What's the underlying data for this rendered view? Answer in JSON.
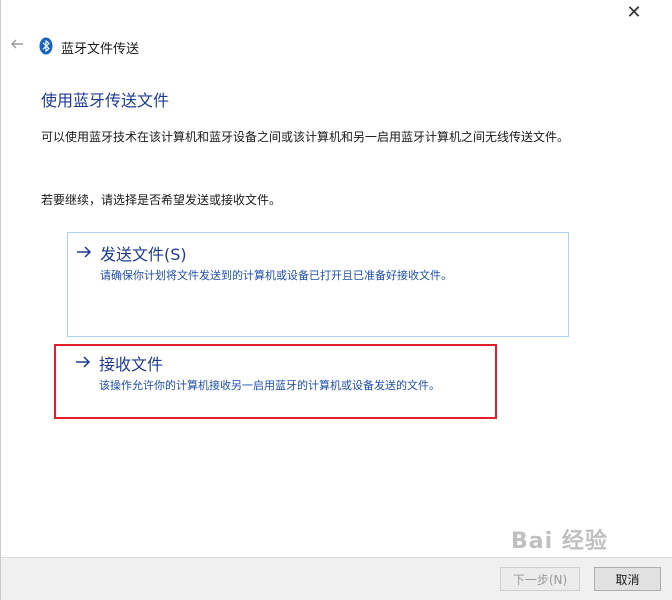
{
  "window": {
    "title": "蓝牙文件传送",
    "close_glyph": "✕"
  },
  "main": {
    "heading": "使用蓝牙传送文件",
    "description": "可以使用蓝牙技术在该计算机和蓝牙设备之间或该计算机和另一启用蓝牙计算机之间无线传送文件。",
    "prompt": "若要继续，请选择是否希望发送或接收文件。"
  },
  "options": [
    {
      "title": "发送文件(S)",
      "description": "请确保你计划将文件发送到的计算机或设备已打开且已准备好接收文件。"
    },
    {
      "title": "接收文件",
      "description": "该操作允许你的计算机接收另一启用蓝牙的计算机或设备发送的文件。"
    }
  ],
  "footer": {
    "next_label": "下一步(N)",
    "cancel_label": "取消"
  },
  "watermark": "Bai 经验",
  "colors": {
    "accent_text": "#1f3a93",
    "link_text": "#1f4fa8",
    "highlight_border": "#e2202b",
    "option_border": "#a9d3ef"
  },
  "icons": {
    "back": "back-arrow-icon",
    "bluetooth": "bluetooth-icon",
    "option_arrow": "right-arrow-icon"
  }
}
